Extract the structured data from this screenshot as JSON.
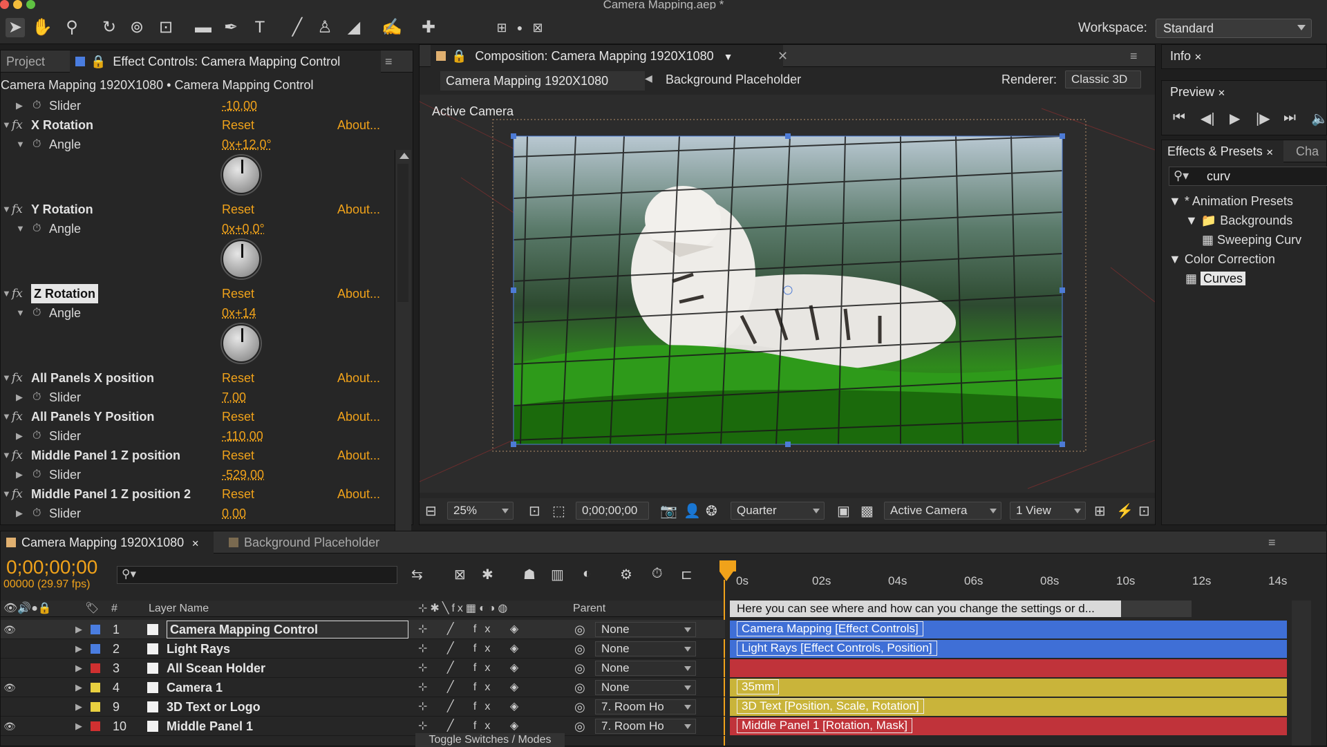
{
  "window": {
    "title": "Camera Mapping.aep *"
  },
  "toolbar": {
    "workspace_label": "Workspace:",
    "workspace_value": "Standard"
  },
  "left_panel": {
    "tab_project": "Project",
    "tab_effects": "Effect Controls: Camera Mapping Control",
    "breadcrumb": "Camera Mapping 1920X1080 • Camera Mapping Control",
    "rows": [
      {
        "kind": "sub",
        "label": "Slider",
        "value": "-10,00"
      },
      {
        "kind": "fx",
        "label": "X Rotation",
        "reset": "Reset",
        "about": "About..."
      },
      {
        "kind": "sub",
        "label": "Angle",
        "value": "0x+12,0°"
      },
      {
        "kind": "fx",
        "label": "Y Rotation",
        "reset": "Reset",
        "about": "About..."
      },
      {
        "kind": "sub",
        "label": "Angle",
        "value": "0x+0,0°"
      },
      {
        "kind": "fx",
        "label": "Z Rotation",
        "reset": "Reset",
        "about": "About..."
      },
      {
        "kind": "sub",
        "label": "Angle",
        "value": "0x+14"
      },
      {
        "kind": "fx",
        "label": "All Panels X position",
        "reset": "Reset",
        "about": "About..."
      },
      {
        "kind": "sub",
        "label": "Slider",
        "value": "7,00"
      },
      {
        "kind": "fx",
        "label": "All Panels Y Position",
        "reset": "Reset",
        "about": "About..."
      },
      {
        "kind": "sub",
        "label": "Slider",
        "value": "-110,00"
      },
      {
        "kind": "fx",
        "label": "Middle Panel 1 Z position",
        "reset": "Reset",
        "about": "About..."
      },
      {
        "kind": "sub",
        "label": "Slider",
        "value": "-529,00"
      },
      {
        "kind": "fx",
        "label": "Middle Panel 1 Z position 2",
        "reset": "Reset",
        "about": "About..."
      },
      {
        "kind": "sub",
        "label": "Slider",
        "value": "0,00"
      }
    ]
  },
  "comp_panel": {
    "tab": "Composition: Camera Mapping 1920X1080",
    "crumb1": "Camera Mapping 1920X1080",
    "crumb2": "Background Placeholder",
    "renderer_label": "Renderer:",
    "renderer_value": "Classic 3D",
    "view_label": "Active Camera",
    "zoom": "25%",
    "timecode": "0;00;00;00",
    "resolution": "Quarter",
    "camera": "Active Camera",
    "views": "1 View"
  },
  "right_panel": {
    "info_tab": "Info",
    "preview_tab": "Preview",
    "effects_tab": "Effects & Presets",
    "char_tab": "Cha",
    "search_value": "curv",
    "tree": [
      {
        "label": "* Animation Presets",
        "level": 0
      },
      {
        "label": "Backgrounds",
        "level": 1
      },
      {
        "label": "Sweeping Curv",
        "level": 2
      },
      {
        "label": "Color Correction",
        "level": 0
      },
      {
        "label": "Curves",
        "level": 1
      }
    ]
  },
  "timeline": {
    "tab1": "Camera Mapping 1920X1080",
    "tab2": "Background Placeholder",
    "timecode": "0;00;00;00",
    "frames": "00000 (29.97 fps)",
    "col_hash": "#",
    "col_layer": "Layer Name",
    "col_parent": "Parent",
    "ruler": [
      "0s",
      "02s",
      "04s",
      "06s",
      "08s",
      "10s",
      "12s",
      "14s"
    ],
    "comment": "Here you can see where and how can you change the settings or d...",
    "toggle_label": "Toggle Switches / Modes",
    "layers": [
      {
        "num": "1",
        "name": "Camera Mapping Control",
        "parent": "None",
        "color": "#4a7de0",
        "bar_color": "#3f6fd6",
        "bar_label": "Camera Mapping [Effect Controls]"
      },
      {
        "num": "2",
        "name": "Light Rays",
        "parent": "None",
        "color": "#4a7de0",
        "bar_color": "#3f6fd6",
        "bar_label": "Light Rays [Effect Controls, Position]"
      },
      {
        "num": "3",
        "name": "All Scean Holder",
        "parent": "None",
        "color": "#d03030",
        "bar_color": "#c0333a",
        "bar_label": ""
      },
      {
        "num": "4",
        "name": "Camera 1",
        "parent": "None",
        "color": "#e8d040",
        "bar_color": "#c9b43a",
        "bar_label": "35mm"
      },
      {
        "num": "9",
        "name": "3D Text or Logo",
        "parent": "7. Room Ho",
        "color": "#e8d040",
        "bar_color": "#c9b43a",
        "bar_label": "3D Text [Position, Scale, Rotation]"
      },
      {
        "num": "10",
        "name": "Middle Panel 1",
        "parent": "7. Room Ho",
        "color": "#d03030",
        "bar_color": "#c0333a",
        "bar_label": "Middle Panel 1 [Rotation, Mask]"
      }
    ]
  }
}
